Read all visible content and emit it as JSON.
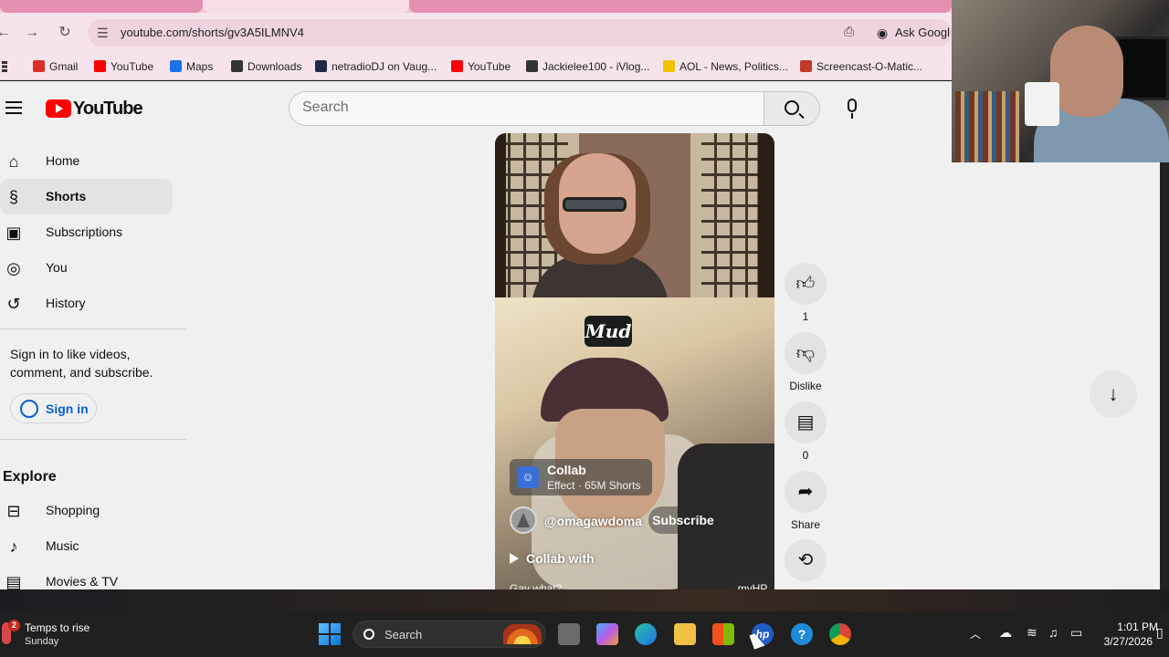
{
  "browser": {
    "url": "youtube.com/shorts/gv3A5ILMNV4",
    "ask_google": "Ask Googl",
    "bookmarks": [
      {
        "label": "Gmail",
        "icon": "gmail-icon",
        "color": "#d93025"
      },
      {
        "label": "YouTube",
        "icon": "youtube-icon",
        "color": "#ff0000"
      },
      {
        "label": "Maps",
        "icon": "maps-pin-icon",
        "color": "#1a73e8"
      },
      {
        "label": "Downloads",
        "icon": "download-icon",
        "color": "#333333"
      },
      {
        "label": "netradioDJ on Vaug...",
        "icon": "netradio-icon",
        "color": "#1f2a44"
      },
      {
        "label": "YouTube",
        "icon": "youtube-icon",
        "color": "#ff0000"
      },
      {
        "label": "Jackielee100 - iVlog...",
        "icon": "ivlog-icon",
        "color": "#333333"
      },
      {
        "label": "AOL - News, Politics...",
        "icon": "aol-icon",
        "color": "#f2c200"
      },
      {
        "label": "Screencast-O-Matic...",
        "icon": "screencast-icon",
        "color": "#c0392b"
      }
    ]
  },
  "youtube": {
    "logo_text": "YouTube",
    "search_placeholder": "Search",
    "nav": [
      {
        "label": "Home",
        "icon": "home-icon",
        "glyph": "⌂",
        "active": false
      },
      {
        "label": "Shorts",
        "icon": "shorts-icon",
        "glyph": "§",
        "active": true
      },
      {
        "label": "Subscriptions",
        "icon": "subscriptions-icon",
        "glyph": "▣",
        "active": false
      },
      {
        "label": "You",
        "icon": "you-icon",
        "glyph": "◎",
        "active": false
      },
      {
        "label": "History",
        "icon": "history-icon",
        "glyph": "↺",
        "active": false
      }
    ],
    "signin_prompt": "Sign in to like videos, comment, and subscribe.",
    "signin_label": "Sign in",
    "explore_title": "Explore",
    "explore": [
      {
        "label": "Shopping",
        "icon": "shopping-bag-icon",
        "glyph": "⊟"
      },
      {
        "label": "Music",
        "icon": "music-note-icon",
        "glyph": "♪"
      },
      {
        "label": "Movies & TV",
        "icon": "film-icon",
        "glyph": "▤"
      }
    ],
    "short": {
      "badge": "Mud",
      "collab_title": "Collab",
      "collab_sub": "Effect · 65M Shorts",
      "channel": "@omagawdoma",
      "subscribe": "Subscribe",
      "title": "Collab with",
      "cut_text": "Gay what?"
    },
    "actions": {
      "like_count": "1",
      "dislike": "Dislike",
      "comments_count": "0",
      "share": "Share"
    },
    "tooltip": "myHP"
  },
  "taskbar": {
    "weather_badge": "2",
    "weather_title": "Temps to rise",
    "weather_sub": "Sunday",
    "search_label": "Search",
    "time": "1:01 PM",
    "date": "3/27/2026"
  }
}
